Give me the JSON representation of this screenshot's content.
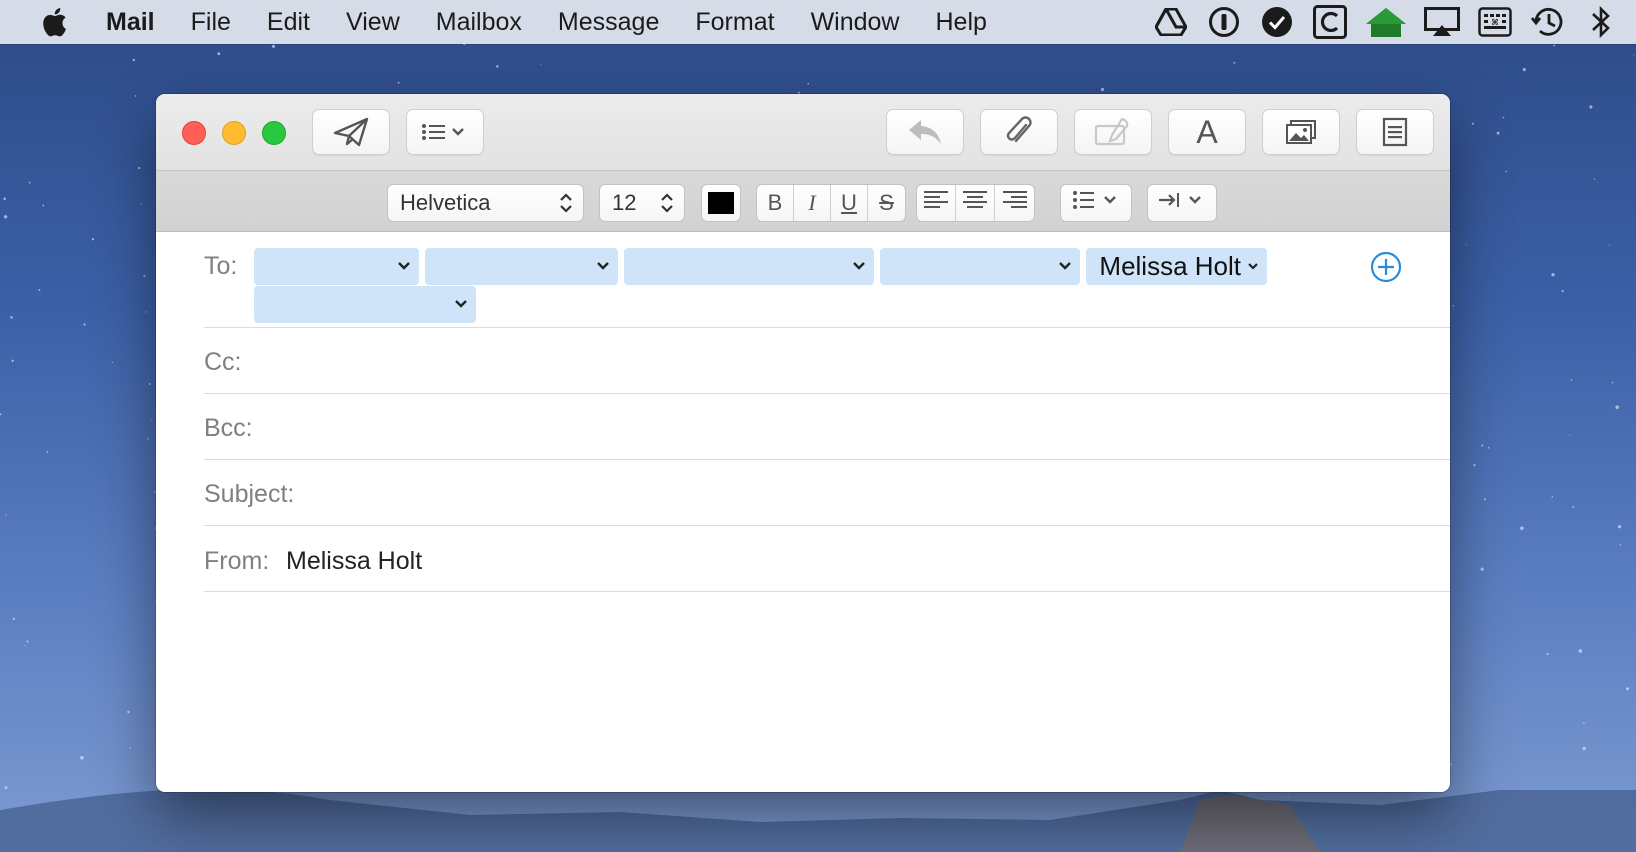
{
  "menubar": {
    "apple_icon": "apple-logo",
    "app_name": "Mail",
    "menus": [
      "File",
      "Edit",
      "View",
      "Mailbox",
      "Message",
      "Format",
      "Window",
      "Help"
    ],
    "status_icons": [
      "google-drive-icon",
      "1password-icon",
      "checkmark-circle-icon",
      "c-app-icon",
      "home-icon",
      "airplay-icon",
      "keyboard-viewer-icon",
      "time-machine-icon",
      "bluetooth-icon"
    ]
  },
  "compose": {
    "toolbar": {
      "send": "paper-plane-icon",
      "header_fields": "list-with-chevron-icon",
      "reply": "reply-arrow-icon",
      "attach": "paperclip-icon",
      "markup": "markup-pen-icon",
      "fonts": "A",
      "photo_browser": "photo-icon",
      "stationery": "stationery-icon"
    },
    "format": {
      "font_family": "Helvetica",
      "font_size": "12",
      "text_color": "#000000",
      "bold": "B",
      "italic": "I",
      "underline": "U",
      "strikethrough": "S"
    },
    "fields": {
      "to_label": "To:",
      "to_recipient_name": "Melissa Holt",
      "cc_label": "Cc:",
      "bcc_label": "Bcc:",
      "subject_label": "Subject:",
      "from_label": "From:",
      "from_value": "Melissa Holt"
    }
  },
  "colors": {
    "accent": "#2a8cd8",
    "token_bg": "#cfe4f8",
    "close": "#ff5f57",
    "minimize": "#febc2e",
    "zoom": "#28c840"
  }
}
